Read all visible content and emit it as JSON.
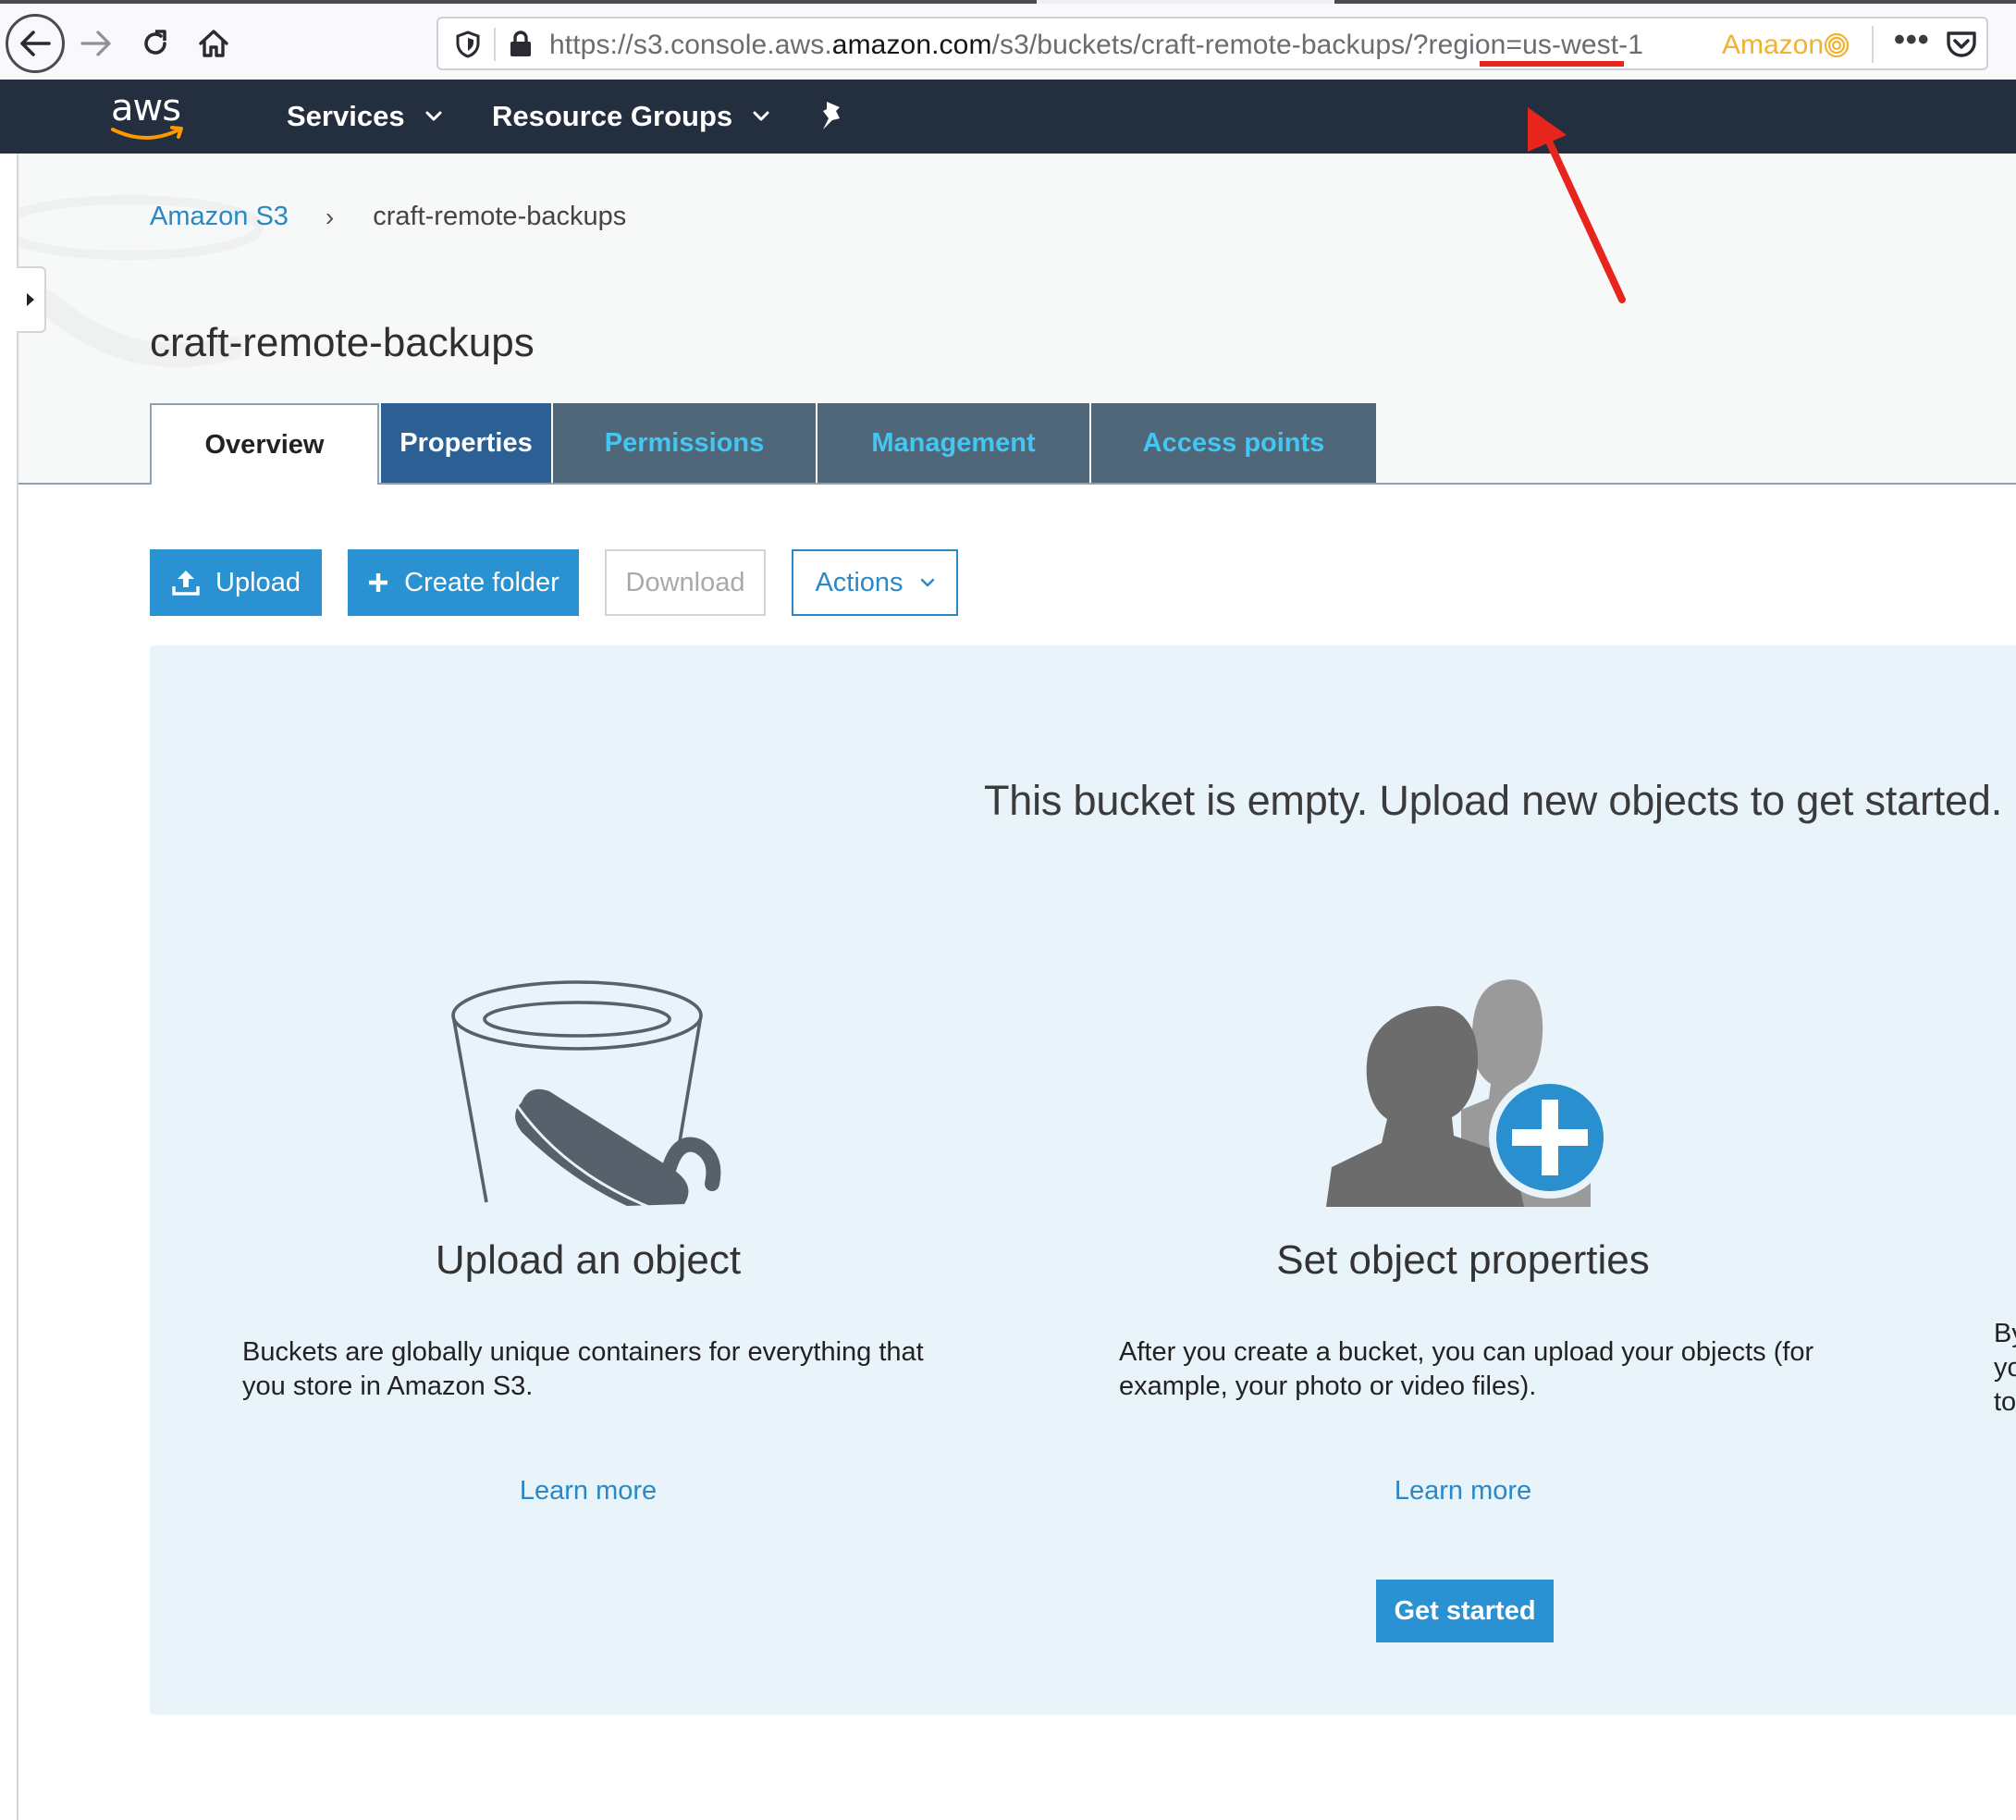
{
  "browser": {
    "url_prefix": "https://s3.console.aws.",
    "url_domain": "amazon.com",
    "url_path": "/s3/buckets/craft-remote-backups/?region=us-west-1",
    "site_label": "Amazon",
    "menu_dots": "•••",
    "icons": [
      "back-arrow-icon",
      "forward-arrow-icon",
      "reload-icon",
      "home-icon",
      "shield-icon",
      "lock-icon",
      "fingerprint-icon",
      "pocket-icon"
    ]
  },
  "aws_nav": {
    "logo": "aws",
    "services": "Services",
    "resource_groups": "Resource Groups",
    "pin_icon": "pushpin-icon",
    "background": "#232f3e"
  },
  "breadcrumb": {
    "root": "Amazon S3",
    "separator": "›",
    "current": "craft-remote-backups"
  },
  "page": {
    "title": "craft-remote-backups"
  },
  "tabs": [
    {
      "label": "Overview",
      "active": true
    },
    {
      "label": "Properties"
    },
    {
      "label": "Permissions"
    },
    {
      "label": "Management"
    },
    {
      "label": "Access points"
    }
  ],
  "toolbar": {
    "upload": "Upload",
    "create_folder": "Create folder",
    "download": "Download",
    "actions": "Actions"
  },
  "empty_state": {
    "message": "This bucket is empty. Upload new objects to get started.",
    "cards": [
      {
        "title": "Upload an object",
        "description": "Buckets are globally unique containers for everything that you store in Amazon S3.",
        "link": "Learn more",
        "icon": "bucket-icon"
      },
      {
        "title": "Set object properties",
        "description": "After you create a bucket, you can upload your objects (for example, your photo or video files).",
        "link": "Learn more",
        "button": "Get started",
        "icon": "users-add-icon"
      },
      {
        "description": "By\nyo\nto"
      }
    ]
  },
  "colors": {
    "accent": "#2a92d2",
    "link": "#2a88c6",
    "annotation": "#e8251c",
    "panel_bg": "#e9f3fa"
  }
}
